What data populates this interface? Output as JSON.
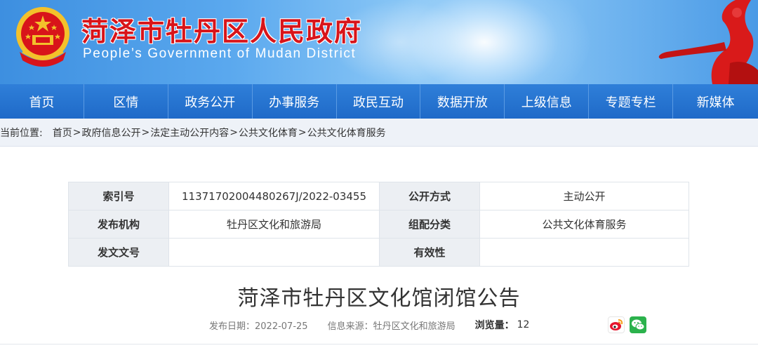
{
  "header": {
    "title": "菏泽市牡丹区人民政府",
    "subtitle": "People’s Government of Mudan District"
  },
  "nav": {
    "items": [
      "首页",
      "区情",
      "政务公开",
      "办事服务",
      "政民互动",
      "数据开放",
      "上级信息",
      "专题专栏",
      "新媒体"
    ]
  },
  "breadcrumb": {
    "label": "当前位置:",
    "items": [
      "首页",
      "政府信息公开",
      "法定主动公开内容",
      "公共文化体育",
      "公共文化体育服务"
    ],
    "separator": ">"
  },
  "meta": {
    "index_label": "索引号",
    "index_value": "11371702004480267J/2022-03455",
    "method_label": "公开方式",
    "method_value": "主动公开",
    "publisher_label": "发布机构",
    "publisher_value": "牡丹区文化和旅游局",
    "category_label": "组配分类",
    "category_value": "公共文化体育服务",
    "docno_label": "发文文号",
    "docno_value": "",
    "validity_label": "有效性",
    "validity_value": ""
  },
  "article": {
    "title": "菏泽市牡丹区文化馆闭馆公告",
    "date_label": "发布日期：2022-07-25",
    "source_label": "信息来源：牡丹区文化和旅游局",
    "views_label": "浏览量：",
    "views_value": "12"
  },
  "colors": {
    "brand_red": "#d8141a",
    "nav_blue": "#1f6ac8",
    "wechat_green": "#2bb24c"
  },
  "icons": {
    "emblem": "national-emblem-icon",
    "share_weibo": "weibo-icon",
    "share_wechat": "wechat-icon"
  }
}
